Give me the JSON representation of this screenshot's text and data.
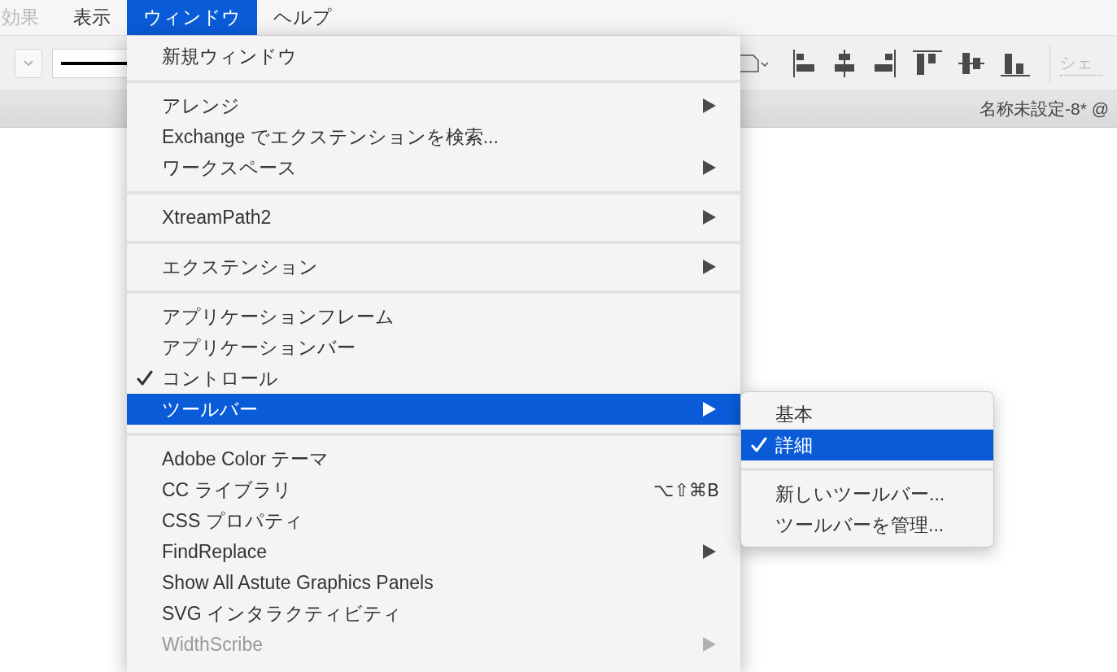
{
  "menu_bar": [
    {
      "label": "効果",
      "selected": false
    },
    {
      "label": "表示",
      "selected": false
    },
    {
      "label": "ウィンドウ",
      "selected": true
    },
    {
      "label": "ヘルプ",
      "selected": false
    }
  ],
  "toolbar": {
    "partial_label": "シェ"
  },
  "document_tab": {
    "title": "名称未設定-8* @"
  },
  "window_menu": [
    {
      "kind": "item",
      "label": "新規ウィンドウ",
      "checked": false,
      "submenu": false,
      "selected": false,
      "disabled": false
    },
    {
      "kind": "separator"
    },
    {
      "kind": "item",
      "label": "アレンジ",
      "checked": false,
      "submenu": true,
      "selected": false,
      "disabled": false
    },
    {
      "kind": "item",
      "label": "Exchange でエクステンションを検索...",
      "checked": false,
      "submenu": false,
      "selected": false,
      "disabled": false
    },
    {
      "kind": "item",
      "label": "ワークスペース",
      "checked": false,
      "submenu": true,
      "selected": false,
      "disabled": false
    },
    {
      "kind": "separator"
    },
    {
      "kind": "item",
      "label": "XtreamPath2",
      "checked": false,
      "submenu": true,
      "selected": false,
      "disabled": false
    },
    {
      "kind": "separator"
    },
    {
      "kind": "item",
      "label": "エクステンション",
      "checked": false,
      "submenu": true,
      "selected": false,
      "disabled": false
    },
    {
      "kind": "separator"
    },
    {
      "kind": "item",
      "label": "アプリケーションフレーム",
      "checked": false,
      "submenu": false,
      "selected": false,
      "disabled": false
    },
    {
      "kind": "item",
      "label": "アプリケーションバー",
      "checked": false,
      "submenu": false,
      "selected": false,
      "disabled": false
    },
    {
      "kind": "item",
      "label": "コントロール",
      "checked": true,
      "submenu": false,
      "selected": false,
      "disabled": false
    },
    {
      "kind": "item",
      "label": "ツールバー",
      "checked": false,
      "submenu": true,
      "selected": true,
      "disabled": false
    },
    {
      "kind": "separator"
    },
    {
      "kind": "item",
      "label": "Adobe Color テーマ",
      "checked": false,
      "submenu": false,
      "selected": false,
      "disabled": false
    },
    {
      "kind": "item",
      "label": "CC ライブラリ",
      "checked": false,
      "submenu": false,
      "selected": false,
      "disabled": false,
      "shortcut": "⌥⇧⌘B"
    },
    {
      "kind": "item",
      "label": "CSS プロパティ",
      "checked": false,
      "submenu": false,
      "selected": false,
      "disabled": false
    },
    {
      "kind": "item",
      "label": "FindReplace",
      "checked": false,
      "submenu": true,
      "selected": false,
      "disabled": false
    },
    {
      "kind": "item",
      "label": "Show All Astute Graphics Panels",
      "checked": false,
      "submenu": false,
      "selected": false,
      "disabled": false
    },
    {
      "kind": "item",
      "label": "SVG インタラクティビティ",
      "checked": false,
      "submenu": false,
      "selected": false,
      "disabled": false
    },
    {
      "kind": "item",
      "label": "WidthScribe",
      "checked": false,
      "submenu": true,
      "selected": false,
      "disabled": true
    }
  ],
  "toolbar_submenu": [
    {
      "kind": "item",
      "label": "基本",
      "checked": false,
      "selected": false
    },
    {
      "kind": "item",
      "label": "詳細",
      "checked": true,
      "selected": true
    },
    {
      "kind": "separator"
    },
    {
      "kind": "item",
      "label": "新しいツールバー...",
      "checked": false,
      "selected": false
    },
    {
      "kind": "item",
      "label": "ツールバーを管理...",
      "checked": false,
      "selected": false
    }
  ]
}
